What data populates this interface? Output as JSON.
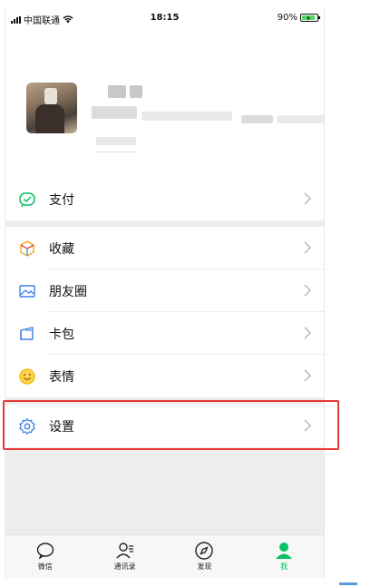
{
  "status_bar": {
    "carrier": "中国联通",
    "time": "18:15",
    "battery": "90%"
  },
  "menu": {
    "pay": {
      "label": "支付",
      "icon": "pay-icon"
    },
    "favorites": {
      "label": "收藏",
      "icon": "cube-icon"
    },
    "moments": {
      "label": "朋友圈",
      "icon": "image-icon"
    },
    "cards": {
      "label": "卡包",
      "icon": "wallet-icon"
    },
    "stickers": {
      "label": "表情",
      "icon": "smiley-icon"
    },
    "settings": {
      "label": "设置",
      "icon": "gear-icon"
    }
  },
  "tabbar": {
    "chats": "微信",
    "contacts": "通讯录",
    "discover": "发现",
    "me": "我"
  },
  "colors": {
    "accent_green": "#07c160",
    "highlight_red": "#e53935"
  }
}
